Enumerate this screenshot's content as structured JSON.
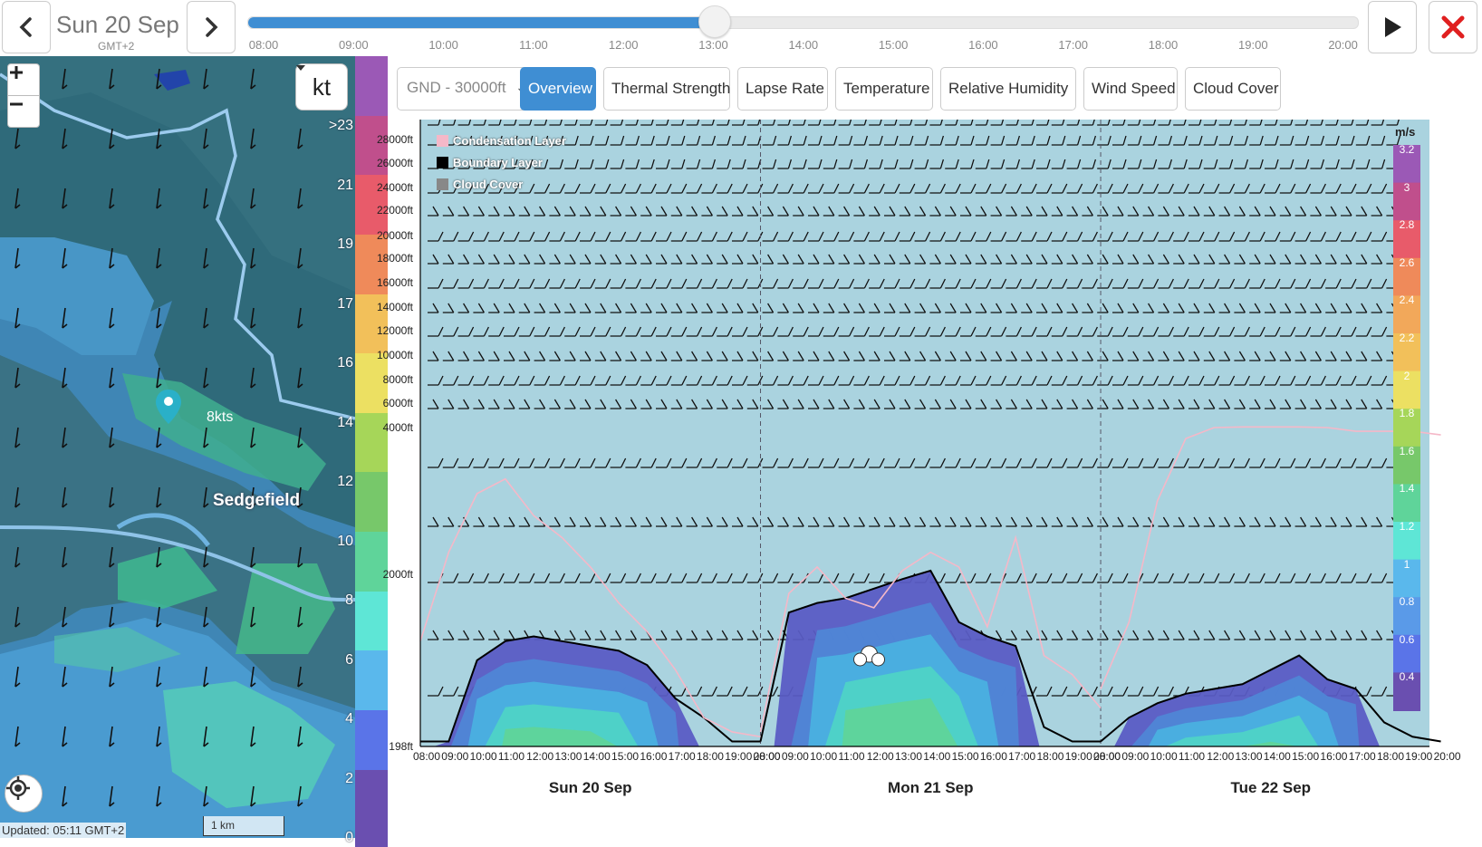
{
  "header": {
    "date": "Sun 20 Sep",
    "timezone": "GMT+2",
    "timeline_progress": 0.42,
    "times": [
      "08:00",
      "09:00",
      "10:00",
      "11:00",
      "12:00",
      "13:00",
      "14:00",
      "15:00",
      "16:00",
      "17:00",
      "18:00",
      "19:00",
      "20:00"
    ]
  },
  "map": {
    "unit": "kt",
    "place": "Sedgefield",
    "marker_speed": "8kts",
    "scale": "1 km",
    "updated": "Updated: 05:11 GMT+2",
    "legend_labels": [
      ">23",
      "21",
      "19",
      "17",
      "16",
      "14",
      "12",
      "10",
      "8",
      "6",
      "4",
      "2",
      "0"
    ],
    "legend_colors": [
      "#9b59b6",
      "#c04f8c",
      "#e85b6a",
      "#ef8a5a",
      "#f2c05a",
      "#ece062",
      "#a6d659",
      "#77c86a",
      "#5fd49a",
      "#5ee6d6",
      "#5ab8ec",
      "#5a74e8",
      "#6a4fb0"
    ]
  },
  "panel": {
    "altitude_range": "GND - 30000ft",
    "tabs": [
      "Overview",
      "Thermal Strength",
      "Lapse Rate",
      "Temperature",
      "Relative Humidity",
      "Wind Speed",
      "Cloud Cover"
    ],
    "active_tab": "Overview"
  },
  "chart_data": {
    "type": "area",
    "title": "",
    "legend": [
      "Condensation Layer",
      "Boundary Layer",
      "Cloud Cover"
    ],
    "colors": {
      "condensation": "#f5b8c8",
      "boundary": "#000000",
      "cloud": "#888888",
      "background": "#aad3df"
    },
    "y_tick_labels": [
      "28000ft",
      "26000ft",
      "24000ft",
      "22000ft",
      "20000ft",
      "18000ft",
      "16000ft",
      "14000ft",
      "12000ft",
      "10000ft",
      "8000ft",
      "6000ft",
      "4000ft",
      "2000ft",
      "198ft"
    ],
    "x_tick_labels": [
      "08:00",
      "09:00",
      "10:00",
      "11:00",
      "12:00",
      "13:00",
      "14:00",
      "15:00",
      "16:00",
      "17:00",
      "18:00",
      "19:00",
      "20:00"
    ],
    "days": [
      "Sun 20 Sep",
      "Mon 21 Sep",
      "Tue 22 Sep"
    ],
    "scale_unit": "m/s",
    "scale_labels": [
      "3.2",
      "3",
      "2.8",
      "2.6",
      "2.4",
      "2.2",
      "2",
      "1.8",
      "1.6",
      "1.4",
      "1.2",
      "1",
      "0.8",
      "0.6",
      "0.4"
    ],
    "scale_colors": [
      "#9b59b6",
      "#c04f8c",
      "#e85b6a",
      "#ef8a5a",
      "#f2a85a",
      "#f2c05a",
      "#ece062",
      "#a6d659",
      "#77c86a",
      "#5fd49a",
      "#5ee6d6",
      "#5ab8ec",
      "#5a9ae8",
      "#5a74e8",
      "#6a4fb0"
    ],
    "boundary_layer_ft": [
      [
        250,
        250,
        1100,
        1300,
        1350,
        1300,
        1250,
        1200,
        1050,
        700,
        500,
        250,
        250
      ],
      [
        250,
        1600,
        1700,
        1750,
        1850,
        1950,
        2050,
        1500,
        1350,
        1250,
        400,
        250,
        250
      ],
      [
        250,
        500,
        650,
        750,
        800,
        850,
        1000,
        1150,
        900,
        800,
        450,
        300,
        250
      ]
    ],
    "condensation_layer_ft": [
      [
        1300,
        2300,
        3100,
        3300,
        2800,
        2500,
        2100,
        1700,
        1400,
        1000,
        500,
        350,
        300
      ],
      [
        350,
        1800,
        2100,
        1750,
        1650,
        2050,
        2300,
        2100,
        1450,
        2500,
        1150,
        950,
        600
      ],
      [
        800,
        1500,
        3000,
        3850,
        4000,
        4050,
        4050,
        4050,
        4000,
        3950,
        3950,
        3950,
        3900
      ]
    ]
  }
}
